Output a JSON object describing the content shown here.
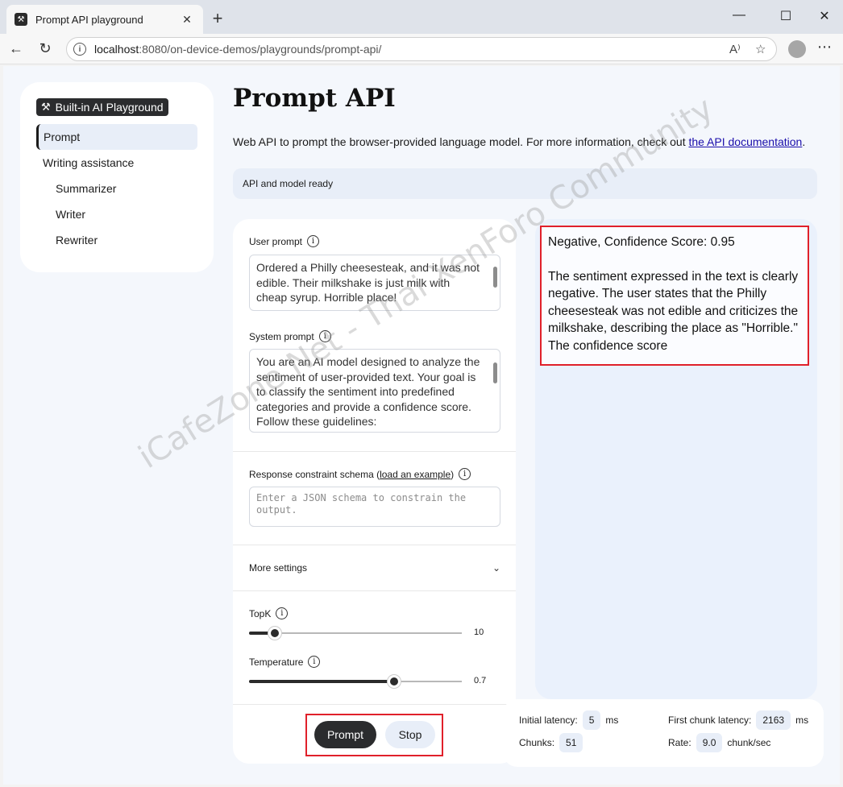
{
  "browser": {
    "tab_title": "Prompt API playground",
    "tab_close": "✕",
    "new_tab": "+",
    "url_host": "localhost",
    "url_path": ":8080/on-device-demos/playgrounds/prompt-api/",
    "minimize": "—",
    "maximize": "☐",
    "close": "✕",
    "back": "←",
    "reload": "↻",
    "read_aloud": "A⁾",
    "favorite": "☆",
    "more": "⋯"
  },
  "sidebar": {
    "brand": "Built-in AI Playground",
    "items": [
      {
        "label": "Prompt"
      },
      {
        "label": "Writing assistance"
      },
      {
        "label": "Summarizer"
      },
      {
        "label": "Writer"
      },
      {
        "label": "Rewriter"
      }
    ]
  },
  "main": {
    "title": "Prompt API",
    "description": "Web API to prompt the browser-provided language model. For more information, check out ",
    "doc_link": "the API documentation",
    "description_end": ".",
    "status": "API and model ready"
  },
  "form": {
    "user_prompt_label": "User prompt",
    "user_prompt_value": "Ordered a Philly cheesesteak, and it was not edible. Their milkshake is just milk with cheap syrup. Horrible place!",
    "system_prompt_label": "System prompt",
    "system_prompt_value": "You are an AI model designed to analyze the sentiment of user-provided text. Your goal is to classify the sentiment into predefined categories and provide a confidence score. Follow these guidelines:",
    "schema_label": "Response constraint schema (",
    "schema_link": "load an example",
    "schema_label_end": ")",
    "schema_placeholder": "Enter a JSON schema to constrain the output.",
    "more_settings": "More settings",
    "topk_label": "TopK",
    "topk_value": "10",
    "topk_fraction": 0.12,
    "temperature_label": "Temperature",
    "temperature_value": "0.7",
    "temperature_fraction": 0.68,
    "prompt_button": "Prompt",
    "stop_button": "Stop",
    "info_glyph": "i"
  },
  "response": {
    "line1": "Negative, Confidence Score: 0.95",
    "line2": "The sentiment expressed in the text is clearly negative. The user states that the Philly cheesesteak was not edible and criticizes the milkshake, describing the place as \"Horrible.\" The confidence score"
  },
  "stats": {
    "initial_latency_label": "Initial latency:",
    "initial_latency_value": "5",
    "initial_latency_unit": "ms",
    "first_chunk_label": "First chunk latency:",
    "first_chunk_value": "2163",
    "first_chunk_unit": "ms",
    "chunks_label": "Chunks:",
    "chunks_value": "51",
    "rate_label": "Rate:",
    "rate_value": "9.0",
    "rate_unit": "chunk/sec"
  },
  "watermark": "iCafeZone.Net - Thai XenForo Community",
  "colors": {
    "accent_dark": "#2b2c2e",
    "highlight_red": "#e0202a",
    "panel_blue": "#eaf1fc"
  }
}
